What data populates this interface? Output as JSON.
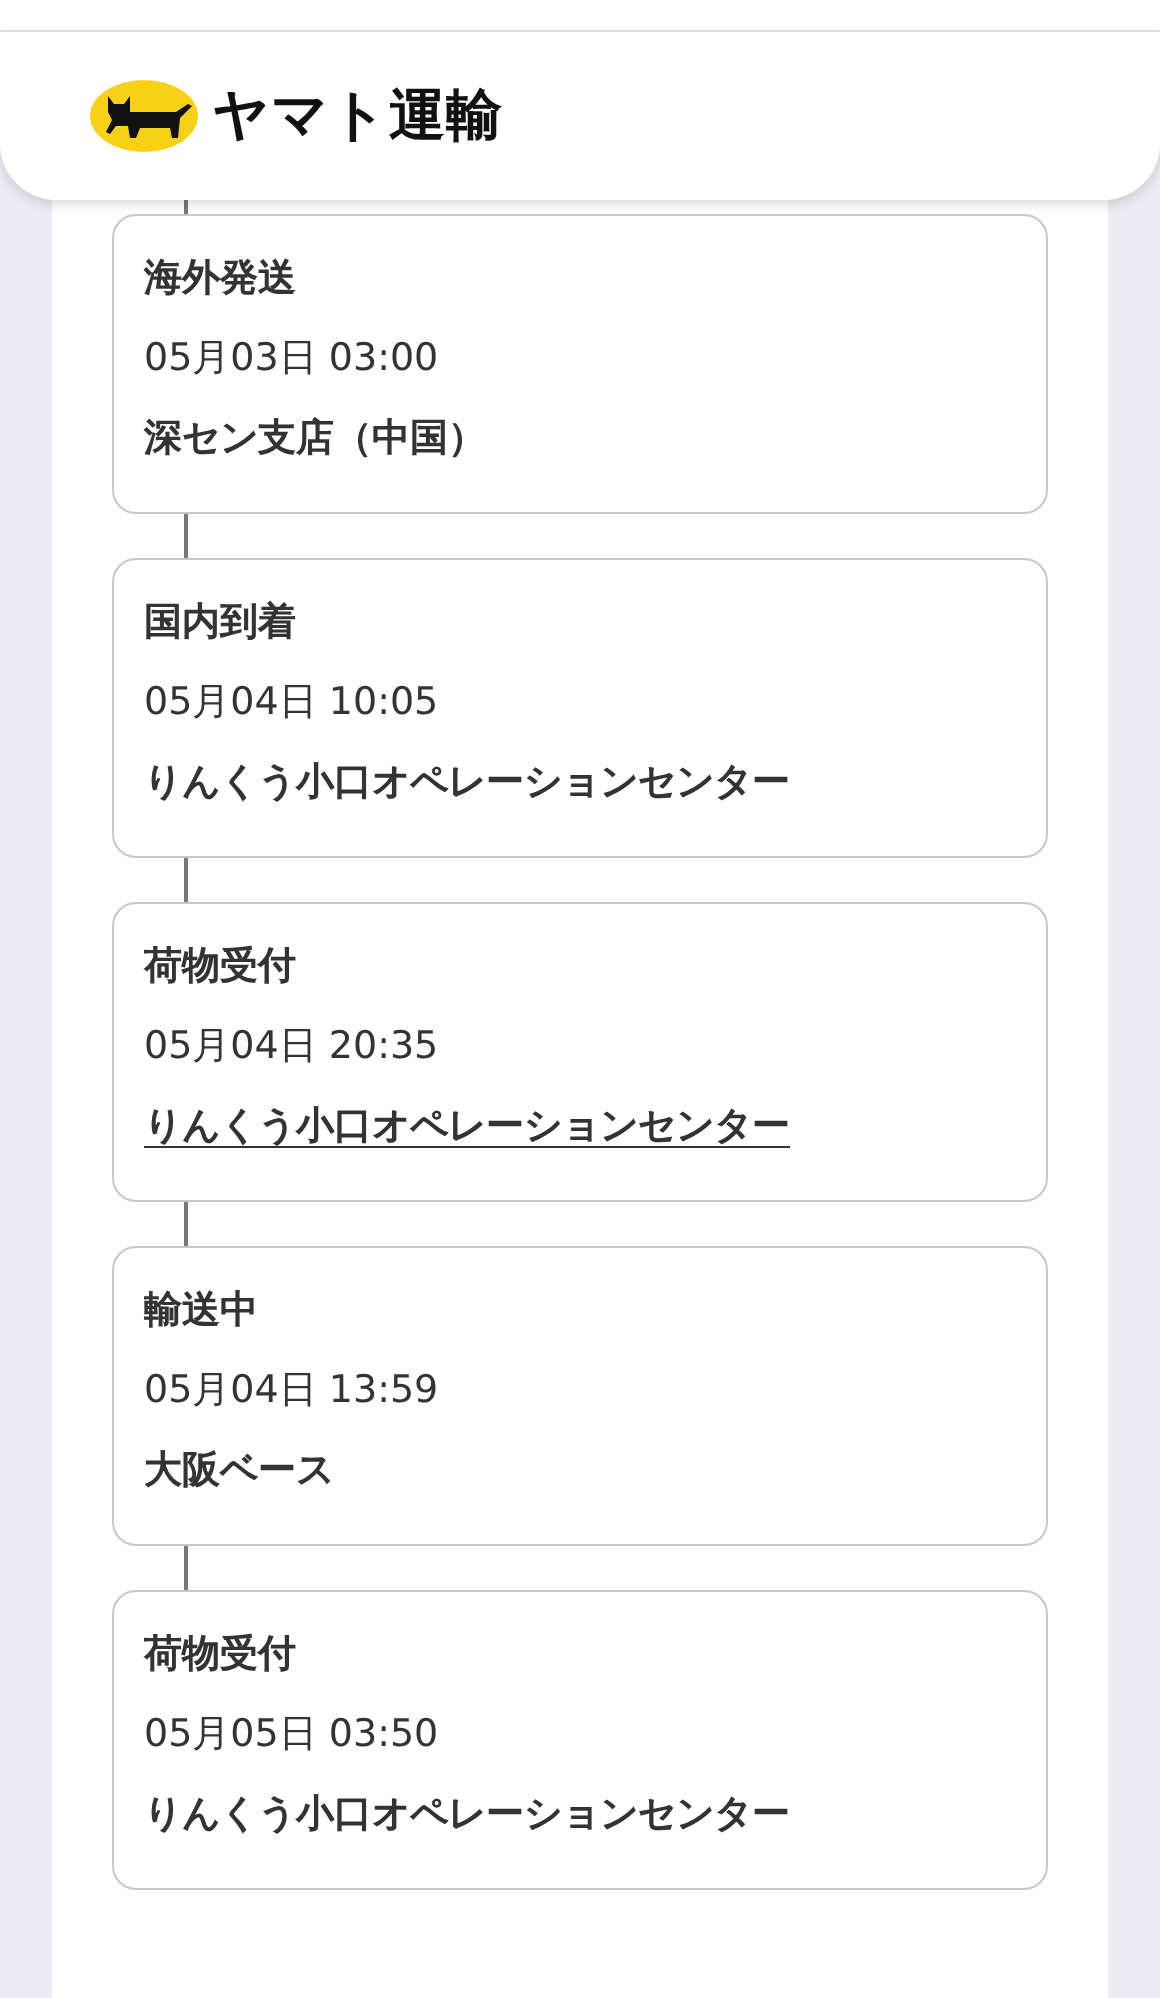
{
  "header": {
    "logo_text": "ヤマト運輸"
  },
  "events": [
    {
      "status": "海外発送",
      "datetime": "05月03日 03:00",
      "location": "深セン支店（中国）",
      "link": false
    },
    {
      "status": "国内到着",
      "datetime": "05月04日 10:05",
      "location": "りんくう小口オペレーションセンター",
      "link": false
    },
    {
      "status": "荷物受付",
      "datetime": "05月04日 20:35",
      "location": "りんくう小口オペレーションセンター",
      "link": true
    },
    {
      "status": "輸送中",
      "datetime": "05月04日 13:59",
      "location": "大阪ベース",
      "link": false
    },
    {
      "status": "荷物受付",
      "datetime": "05月05日 03:50",
      "location": "りんくう小口オペレーションセンター",
      "link": false
    }
  ]
}
